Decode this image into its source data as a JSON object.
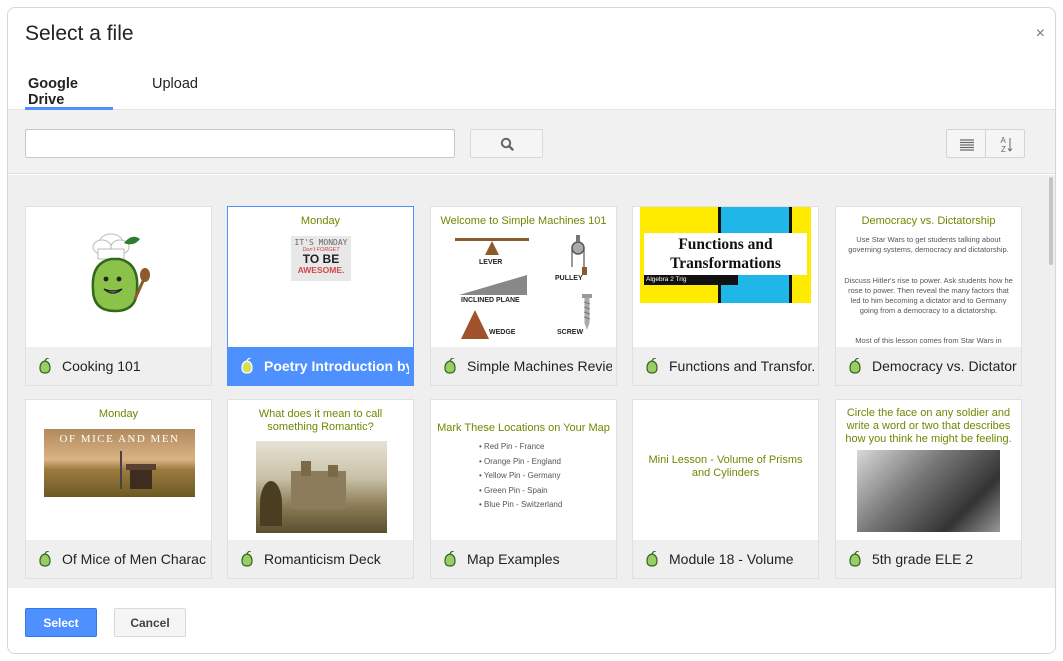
{
  "dialog": {
    "title": "Select a file",
    "close_glyph": "×"
  },
  "tabs": [
    {
      "label": "Google Drive",
      "active": true
    },
    {
      "label": "Upload",
      "active": false
    }
  ],
  "search": {
    "value": "",
    "placeholder": ""
  },
  "icons": {
    "search": "search-icon",
    "list_view": "list-view-icon",
    "sort": "sort-az-icon",
    "file": "pear-deck-icon"
  },
  "colors": {
    "accent": "#4d90fe",
    "title_green": "#6b8a00",
    "pear_green": "#8bc34a"
  },
  "files": [
    {
      "name": "Cooking 101",
      "selected": false,
      "thumb": {}
    },
    {
      "name": "Poetry Introduction by:...",
      "selected": true,
      "thumb": {
        "title": "Monday",
        "line1": "IT'S MONDAY",
        "line2": "Don't FORGET",
        "line3": "TO BE",
        "line4": "AWESOME."
      }
    },
    {
      "name": "Simple Machines Revie...",
      "selected": false,
      "thumb": {
        "title": "Welcome to Simple Machines 101",
        "lever": "LEVER",
        "pulley": "PULLEY",
        "inclined": "INCLINED PLANE",
        "wedge": "WEDGE",
        "screw": "SCREW"
      }
    },
    {
      "name": "Functions and Transfor...",
      "selected": false,
      "thumb": {
        "title": "Functions and Transformations",
        "subtitle": "Algebra 2 Trig"
      }
    },
    {
      "name": "Democracy vs. Dictator...",
      "selected": false,
      "thumb": {
        "title": "Democracy vs. Dictatorship",
        "p1": "Use Star Wars to get students talking about governing systems, democracy and dictatorship.",
        "p2": "Discuss Hitler's rise to power. Ask students how he rose to power. Then reveal the many factors that led to him becoming a dictator and to Germany going from a democracy to a dictatorship.",
        "p3": "Most of this lesson comes from Star Wars in"
      }
    },
    {
      "name": "Of Mice of Men Charac...",
      "selected": false,
      "thumb": {
        "title": "Monday",
        "banner": "OF MICE AND MEN"
      }
    },
    {
      "name": "Romanticism Deck",
      "selected": false,
      "thumb": {
        "title": "What does it mean to call something Romantic?"
      }
    },
    {
      "name": "Map Examples",
      "selected": false,
      "thumb": {
        "title": "Mark These Locations on Your Map",
        "pins": [
          "Red Pin - France",
          "Orange Pin - England",
          "Yellow Pin - Germany",
          "Green Pin - Spain",
          "Blue Pin - Switzerland"
        ]
      }
    },
    {
      "name": "Module 18 - Volume",
      "selected": false,
      "thumb": {
        "title": "Mini Lesson - Volume of Prisms and Cylinders"
      }
    },
    {
      "name": "5th grade ELE 2",
      "selected": false,
      "thumb": {
        "title": "Circle the face on any soldier and write a word or two that describes how you think he might be feeling."
      }
    }
  ],
  "footer": {
    "select_label": "Select",
    "cancel_label": "Cancel"
  }
}
